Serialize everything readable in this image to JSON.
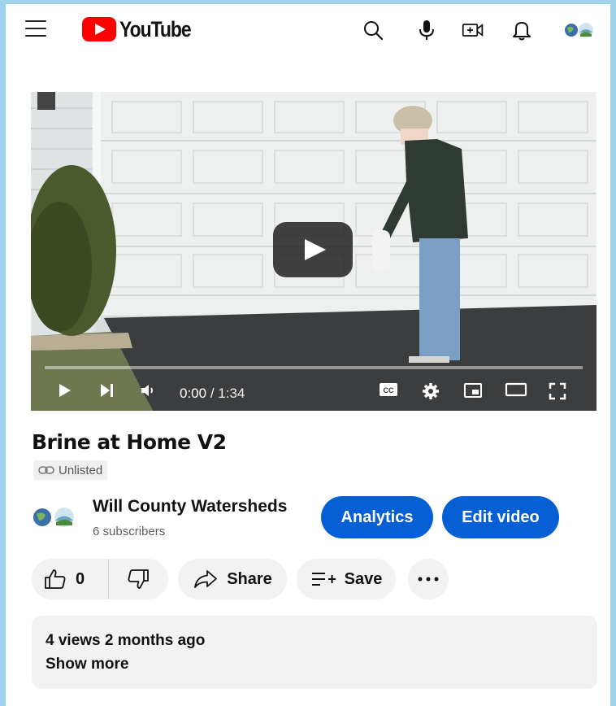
{
  "header": {
    "logo_text": "YouTube",
    "icons": [
      "menu-icon",
      "search-icon",
      "microphone-icon",
      "create-video-icon",
      "notifications-bell-icon",
      "account-avatar-icon"
    ]
  },
  "player": {
    "current_time": "0:00",
    "duration": " / 1:34",
    "progress_fraction": 0.0,
    "buffered_fraction": 0.84
  },
  "video": {
    "title": "Brine at Home V2",
    "visibility": "Unlisted"
  },
  "channel": {
    "name": "Will County Watersheds",
    "subscribers": "6 subscribers",
    "analytics_label": "Analytics",
    "edit_label": "Edit video"
  },
  "actions": {
    "like_count": "0",
    "share_label": "Share",
    "save_label": "Save"
  },
  "description": {
    "meta": "4 views  2 months ago",
    "show_more": "Show more"
  },
  "colors": {
    "brand_red": "#ff0000",
    "button_blue": "#065fd4",
    "pill_gray": "#f2f2f2"
  }
}
